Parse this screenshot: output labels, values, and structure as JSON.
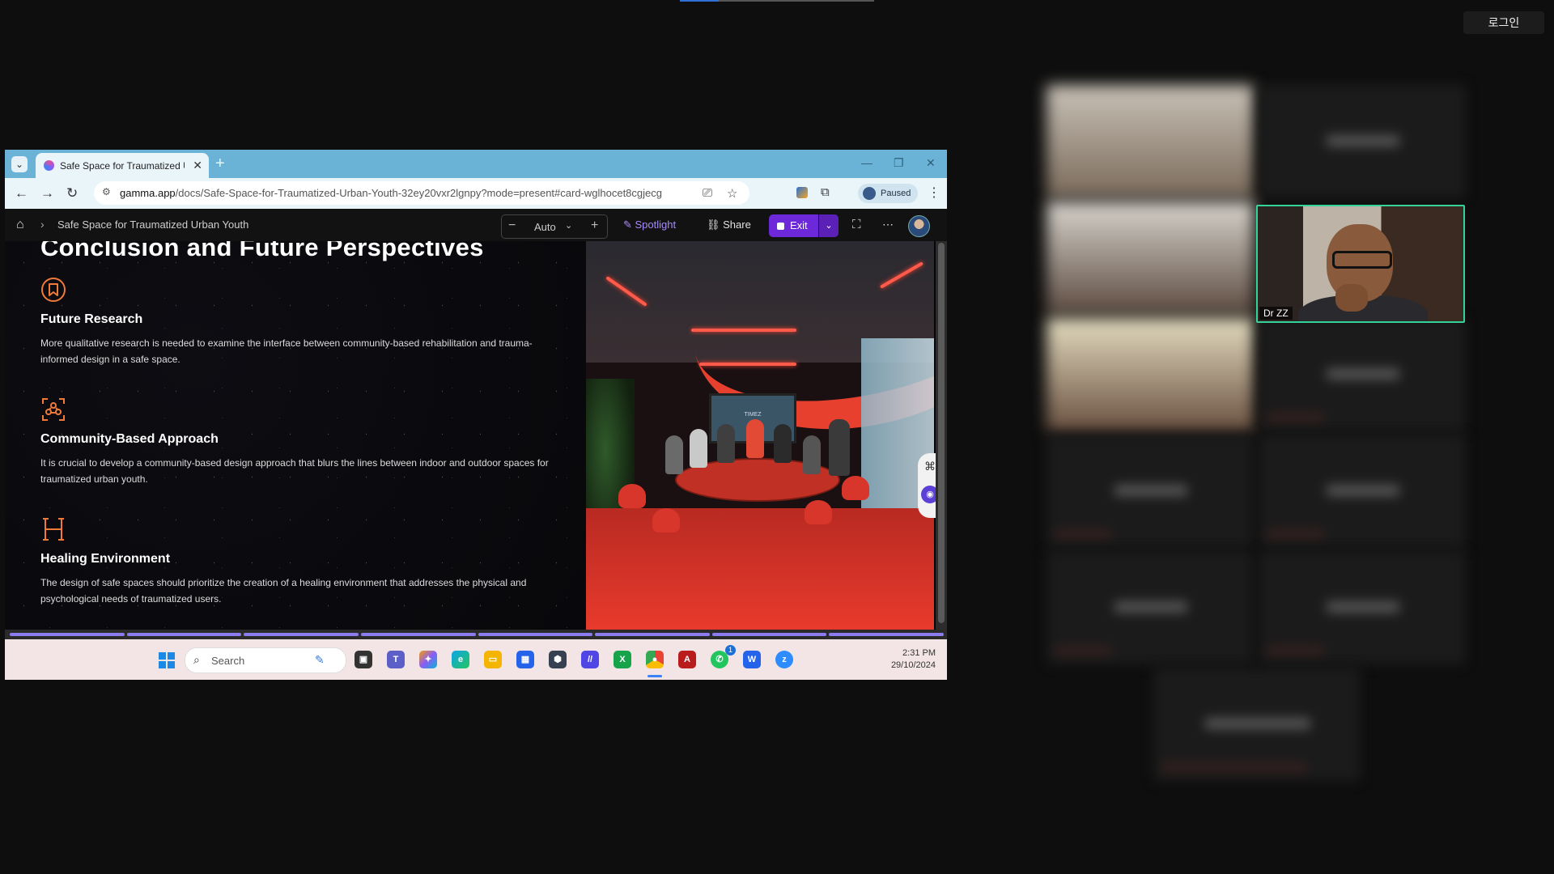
{
  "overlay": {
    "login_label": "로그인"
  },
  "browser": {
    "tab_title": "Safe Space for Traumatized Urb",
    "tab_close": "✕",
    "new_tab": "+",
    "url_host": "gamma.app",
    "url_path": "/docs/Safe-Space-for-Traumatized-Urban-Youth-32ey20vxr2lgnpy?mode=present#card-wglhocet8cgjecg",
    "profile_status": "Paused"
  },
  "gamma": {
    "breadcrumb": "Safe Space for Traumatized Urban Youth",
    "zoom_value": "Auto",
    "spotlight_label": "Spotlight",
    "share_label": "Share",
    "exit_label": "Exit"
  },
  "slide": {
    "title": "Conclusion and Future Perspectives",
    "features": [
      {
        "icon": "bookmark-icon",
        "heading": "Future Research",
        "body": "More qualitative research is needed to examine the interface between community-based rehabilitation and trauma-informed design in a safe space."
      },
      {
        "icon": "community-icon",
        "heading": "Community-Based Approach",
        "body": "It is crucial to develop a community-based design approach that blurs the lines between indoor and outdoor spaces for traumatized urban youth."
      },
      {
        "icon": "letter-h-icon",
        "heading": "Healing Environment",
        "body": "The design of safe spaces should prioritize the creation of a healing environment that addresses the physical and psychological needs of traumatized users."
      }
    ],
    "photo_screen_text": "TIMEZ",
    "progress": {
      "total_cards": 8,
      "current_card": 8
    }
  },
  "taskbar": {
    "search_placeholder": "Search",
    "whatsapp_badge": "1",
    "time": "2:31 PM",
    "date": "29/10/2024"
  },
  "meeting": {
    "active_speaker_name": "Dr ZZ"
  },
  "colors": {
    "accent_purple": "#6d28d9",
    "icon_orange": "#f07a3a",
    "speaker_border": "#34d399",
    "tabbar_blue": "#6bb3d6"
  }
}
